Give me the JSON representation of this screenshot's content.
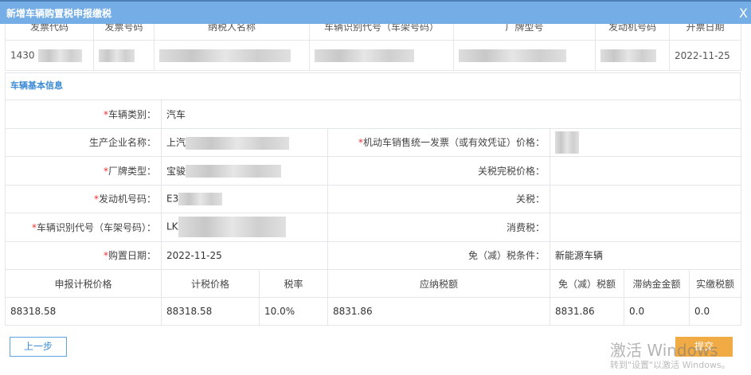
{
  "window": {
    "title": "新增车辆购置税申报缴税",
    "close": "X"
  },
  "invoice_table": {
    "headers": [
      "发票代码",
      "发票号码",
      "纳税人名称",
      "车辆识别代号（车架号码）",
      "厂牌型号",
      "发动机号码",
      "开票日期"
    ],
    "row": {
      "invoice_code": "1430",
      "date": "2022-11-25"
    }
  },
  "section_title": "车辆基本信息",
  "form": {
    "vehicle_type_label": "车辆类别：",
    "vehicle_type": "汽车",
    "manufacturer_label": "生产企业名称：",
    "manufacturer": "上汽",
    "invoice_price_label": "机动车销售统一发票（或有效凭证）价格：",
    "brand_label": "厂牌类型：",
    "brand": "宝骏",
    "customs_price_label": "关税完税价格：",
    "engine_label": "发动机号码：",
    "engine": "E3",
    "tariff_label": "关税：",
    "vin_label": "车辆识别代号（车架号码）：",
    "vin": "LK",
    "consumption_tax_label": "消费税：",
    "purchase_date_label": "购置日期：",
    "purchase_date": "2022-11-25",
    "exemption_label": "免（减）税条件：",
    "exemption": "新能源车辆"
  },
  "tax_table": {
    "headers": [
      "申报计税价格",
      "计税价格",
      "税率",
      "应纳税额",
      "免（减）税额",
      "滞纳金金额",
      "实缴税额"
    ],
    "values": [
      "88318.58",
      "88318.58",
      "10.0%",
      "8831.86",
      "8831.86",
      "0.0",
      "0.0"
    ]
  },
  "buttons": {
    "prev": "上一步",
    "submit": "提交"
  },
  "watermark": {
    "line1": "激活 Windows",
    "line2": "转到\"设置\"以激活 Windows。"
  }
}
